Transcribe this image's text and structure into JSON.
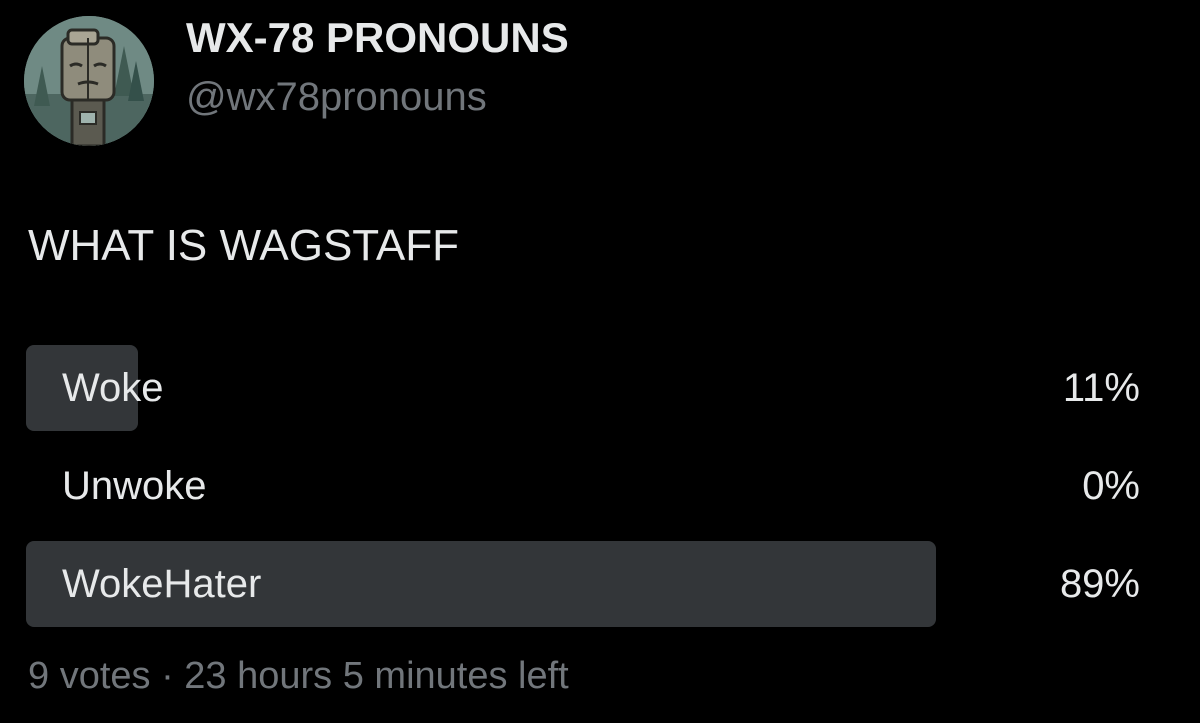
{
  "profile": {
    "display_name": "WX-78 PRONOUNS",
    "handle": "@wx78pronouns"
  },
  "tweet": {
    "text": "WHAT IS WAGSTAFF"
  },
  "poll": {
    "options": [
      {
        "label": "Woke",
        "percent_label": "11%",
        "percent": 11
      },
      {
        "label": "Unwoke",
        "percent_label": "0%",
        "percent": 0
      },
      {
        "label": "WokeHater",
        "percent_label": "89%",
        "percent": 89
      }
    ],
    "meta": "9 votes · 23 hours 5 minutes left"
  },
  "colors": {
    "background": "#000000",
    "text_primary": "#e7e9ea",
    "text_secondary": "#71767b",
    "poll_bar": "#333639"
  }
}
